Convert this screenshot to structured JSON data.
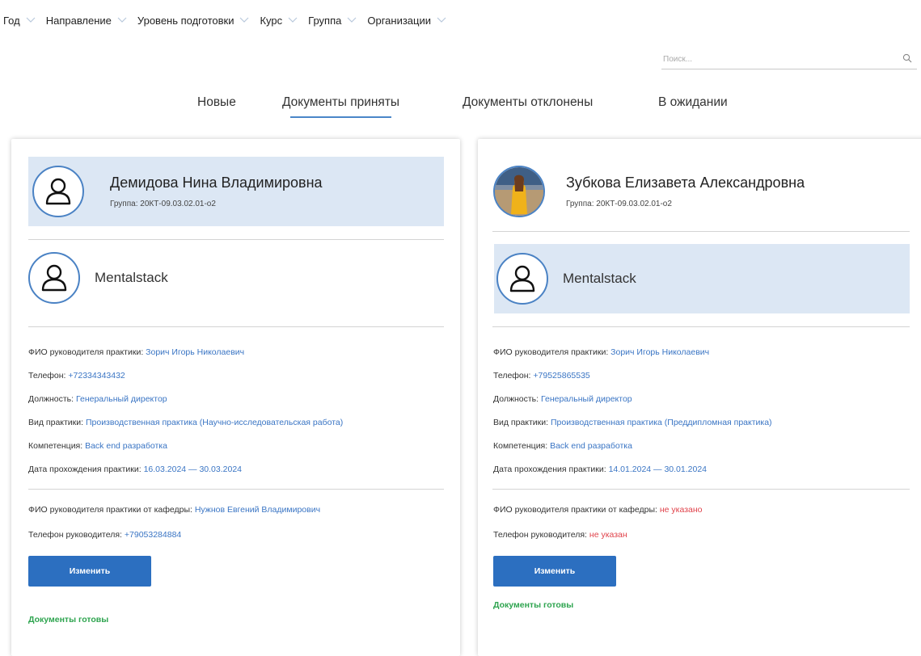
{
  "filters": [
    "Год",
    "Направление",
    "Уровень подготовки",
    "Курс",
    "Группа",
    "Организации"
  ],
  "search": {
    "placeholder": "Поиск..."
  },
  "tabs": [
    "Новые",
    "Документы приняты",
    "Документы отклонены",
    "В ожидании"
  ],
  "active_tab": "Документы приняты",
  "cards": [
    {
      "student_name": "Демидова Нина Владимировна",
      "group": "Группа: 20КТ-09.03.02.01-о2",
      "company": "Mentalstack",
      "rows": [
        {
          "label": "ФИО руководителя практики: ",
          "value": "Зорич Игорь Николаевич"
        },
        {
          "label": "Телефон: ",
          "value": "+72334343432"
        },
        {
          "label": "Должность: ",
          "value": "Генеральный директор"
        },
        {
          "label": "Вид практики: ",
          "value": "Производственная практика (Научно-исследовательская работа)"
        },
        {
          "label": "Компетенция: ",
          "value": "Back end разработка"
        },
        {
          "label": "Дата прохождения практики: ",
          "value": "16.03.2024 — 30.03.2024"
        }
      ],
      "dept_rows": [
        {
          "label": "ФИО руководителя практики от кафедры: ",
          "value": "Нужнов Евгений Владимирович"
        },
        {
          "label": "Телефон руководителя: ",
          "value": "+79053284884"
        }
      ],
      "button": "Изменить",
      "status": "Документы готовы"
    },
    {
      "student_name": "Зубкова Елизавета Александровна",
      "group": "Группа: 20КТ-09.03.02.01-о2",
      "company": "Mentalstack",
      "rows": [
        {
          "label": "ФИО руководителя практики: ",
          "value": "Зорич Игорь Николаевич"
        },
        {
          "label": "Телефон: ",
          "value": "+79525865535"
        },
        {
          "label": "Должность: ",
          "value": "Генеральный директор"
        },
        {
          "label": "Вид практики: ",
          "value": "Производственная практика (Преддипломная практика)"
        },
        {
          "label": "Компетенция: ",
          "value": "Back end разработка"
        },
        {
          "label": "Дата прохождения практики: ",
          "value": "14.01.2024 — 30.01.2024"
        }
      ],
      "dept_rows": [
        {
          "label": "ФИО руководителя практики от кафедры: ",
          "value": "не указано"
        },
        {
          "label": "Телефон руководителя: ",
          "value": "не указан"
        }
      ],
      "button": "Изменить",
      "status": "Документы готовы"
    }
  ],
  "colors": {
    "accent": "#2c6fc0",
    "link": "#3a75c4",
    "missing": "#e0424a",
    "ok": "#2ea44f",
    "highlight": "#dce7f4"
  }
}
